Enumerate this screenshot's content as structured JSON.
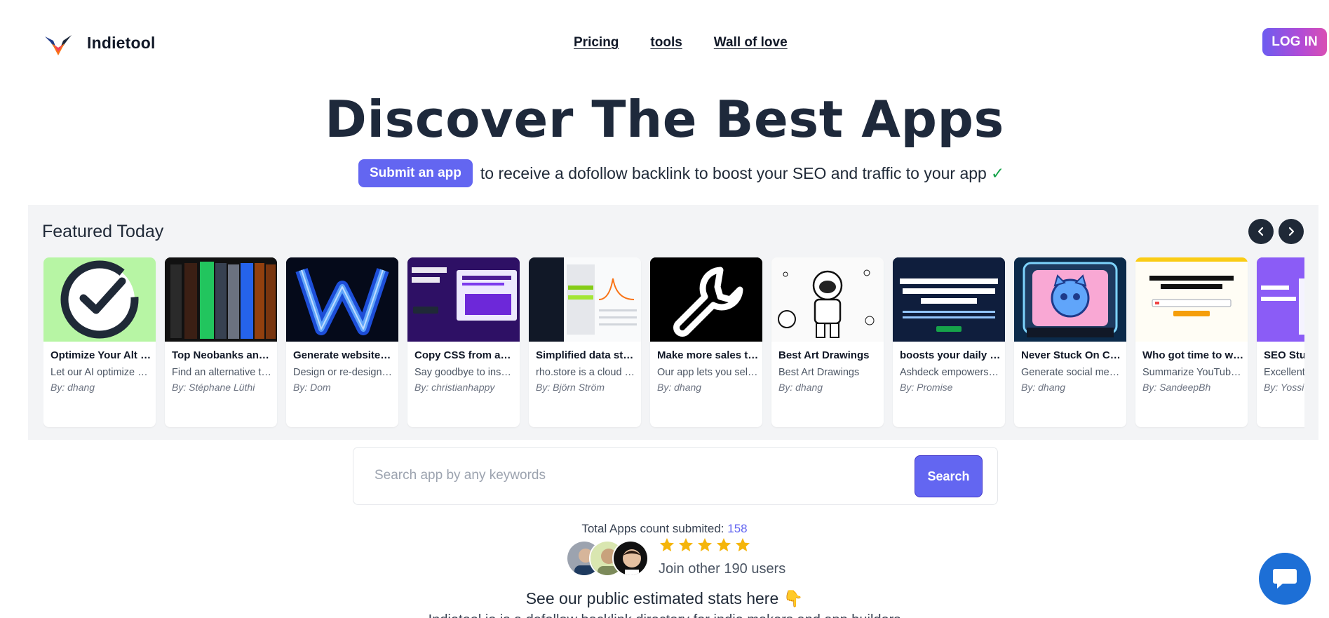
{
  "header": {
    "brand": "Indietool",
    "nav": [
      "Pricing",
      "tools",
      "Wall of love"
    ],
    "login_label": "LOG IN"
  },
  "hero": {
    "title": "Discover The Best Apps",
    "submit_label": "Submit an app",
    "subtitle": "to receive a dofollow backlink to boost your SEO and traffic to your app",
    "check": "✓"
  },
  "featured": {
    "title": "Featured Today",
    "cards": [
      {
        "title": "Optimize Your Alt Text",
        "desc": "Let our AI optimize your alt text",
        "by": "By: dhang"
      },
      {
        "title": "Top Neobanks and Fintech",
        "desc": "Find an alternative to your bank",
        "by": "By: Stéphane Lüthi"
      },
      {
        "title": "Generate websites with AI",
        "desc": "Design or re-design your website",
        "by": "By: Dom"
      },
      {
        "title": "Copy CSS from any website",
        "desc": "Say goodbye to inspecting code",
        "by": "By: christianhappy"
      },
      {
        "title": "Simplified data storage",
        "desc": "rho.store is a cloud database",
        "by": "By: Björn Ström"
      },
      {
        "title": "Make more sales today",
        "desc": "Our app lets you sell more",
        "by": "By: dhang"
      },
      {
        "title": "Best Art Drawings",
        "desc": "Best Art Drawings",
        "by": "By: dhang"
      },
      {
        "title": "boosts your daily focus",
        "desc": "Ashdeck empowers you to focus",
        "by": "By: Promise"
      },
      {
        "title": "Never Stuck On Content",
        "desc": "Generate social media ideas",
        "by": "By: dhang"
      },
      {
        "title": "Who got time to watch",
        "desc": "Summarize YouTube videos",
        "by": "By: SandeepBh"
      },
      {
        "title": "SEO Stuff",
        "desc": "Excellent SEO tools",
        "by": "By: Yossi"
      }
    ]
  },
  "search": {
    "placeholder": "Search app by any keywords",
    "button_label": "Search"
  },
  "stats": {
    "count_label": "Total Apps count submited:",
    "count_value": "158",
    "join_text": "Join other 190 users",
    "rating": 5,
    "public_stats": "See our public estimated stats here 👇",
    "cut_line": "Indietool.io is a dofollow backlink directory for indie makers and app builders"
  },
  "colors": {
    "accent": "#6366f1",
    "dark": "#1e293b",
    "star": "#f5b50a",
    "chat": "#1d6fd6"
  }
}
